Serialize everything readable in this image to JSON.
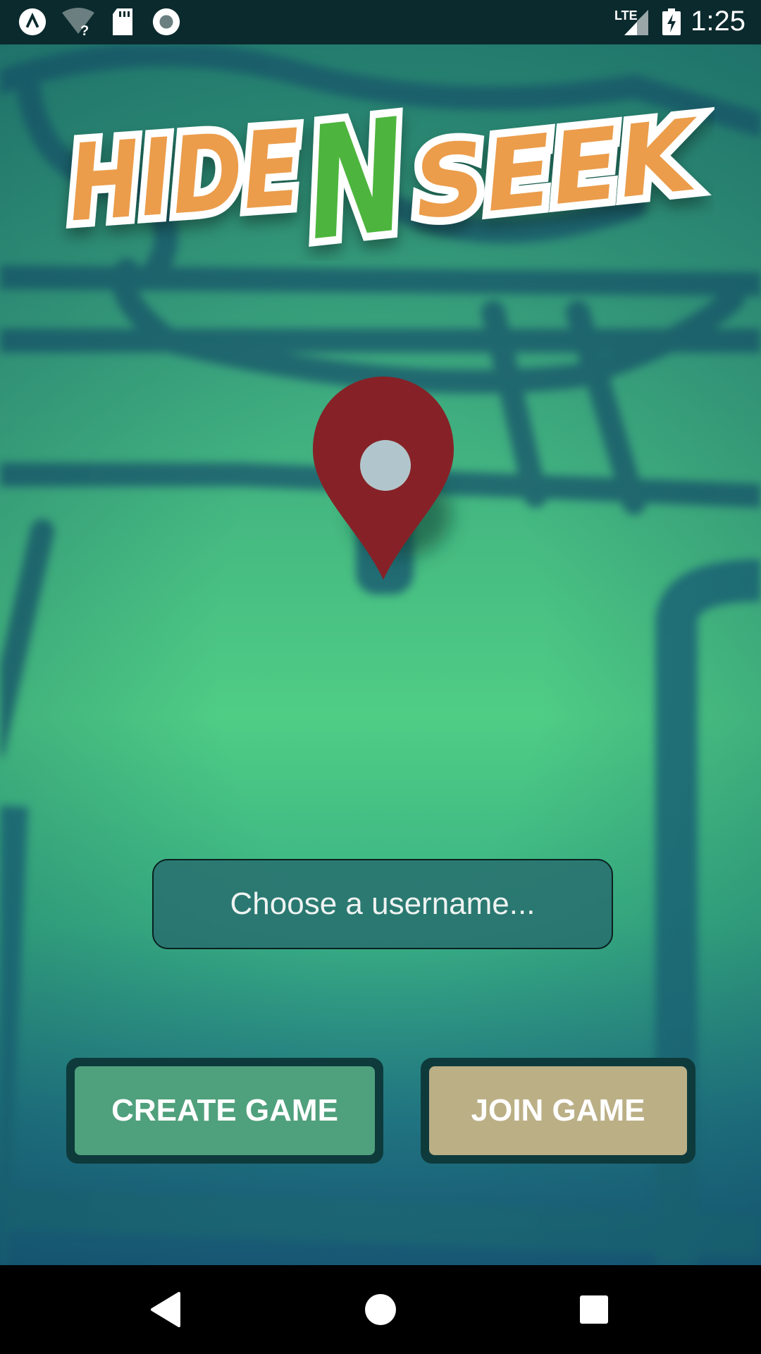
{
  "status_bar": {
    "time": "1:25",
    "network": "LTE",
    "icons": [
      "app-launcher-icon",
      "wifi-unknown-icon",
      "sd-card-icon",
      "record-icon",
      "signal-icon",
      "battery-charging-icon"
    ]
  },
  "logo": {
    "part1": "HIDE",
    "part2": "N",
    "part3": "SEEK",
    "colors": {
      "orange": "#EB9D4B",
      "green": "#4DB53C",
      "outline": "#FFFFFF"
    }
  },
  "username": {
    "placeholder": "Choose a username...",
    "value": ""
  },
  "buttons": {
    "create": "CREATE GAME",
    "join": "JOIN GAME"
  },
  "colors": {
    "pin": "#862227",
    "create_button": "#4FA07C",
    "join_button": "#BBAF86"
  },
  "nav_bar": {
    "icons": [
      "back-icon",
      "home-icon",
      "recents-icon"
    ]
  }
}
